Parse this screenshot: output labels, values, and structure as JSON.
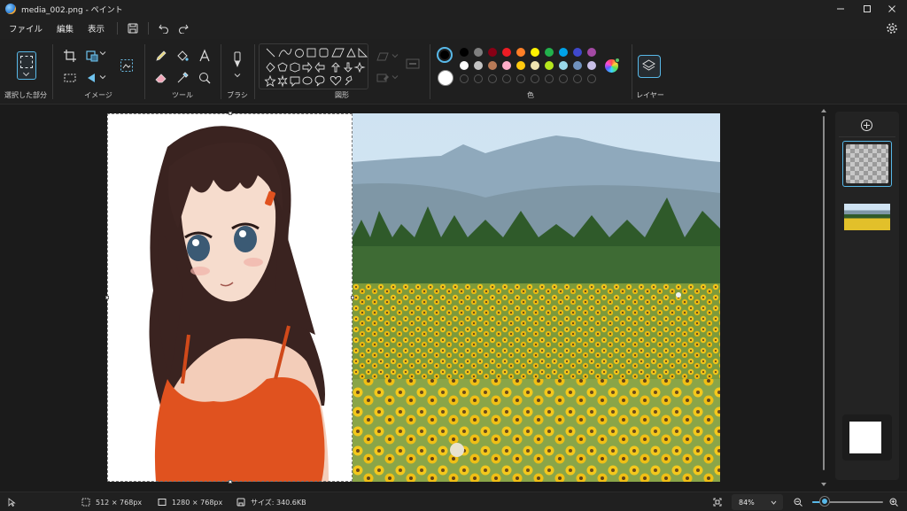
{
  "window": {
    "title": "media_002.png - ペイント",
    "icon": "paint-app-icon"
  },
  "menu": {
    "items": [
      "ファイル",
      "編集",
      "表示"
    ]
  },
  "ribbon": {
    "groups": {
      "selection": "選択した部分",
      "image": "イメージ",
      "tools": "ツール",
      "brushes": "ブラシ",
      "shapes": "図形",
      "colors": "色",
      "layers": "レイヤー"
    },
    "palette_row1": [
      "#000000",
      "#7f7f7f",
      "#880015",
      "#ed1c24",
      "#ff7f27",
      "#fff200",
      "#22b14c",
      "#00a2e8",
      "#3f48cc",
      "#a349a4"
    ],
    "palette_row2": [
      "#ffffff",
      "#c3c3c3",
      "#b97a57",
      "#ffaec9",
      "#ffc90e",
      "#efe4b0",
      "#b5e61d",
      "#99d9ea",
      "#7092be",
      "#c8bfe7"
    ],
    "current_color_1": "#000000",
    "current_color_2": "#ffffff",
    "accent_color": "#58b8e8"
  },
  "status": {
    "selection_size": "512 × 768px",
    "canvas_size": "1280 × 768px",
    "file_size": "サイズ: 340.6KB",
    "zoom": "84%",
    "zoom_fraction": 0.18
  }
}
